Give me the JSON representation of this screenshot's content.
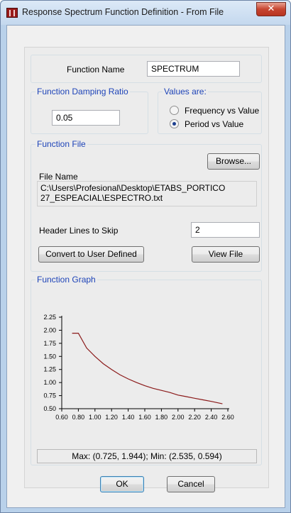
{
  "window": {
    "title": "Response Spectrum Function Definition - From File",
    "close_glyph": "✕"
  },
  "function_name": {
    "label": "Function Name",
    "value": "SPECTRUM"
  },
  "damping": {
    "group_title": "Function Damping Ratio",
    "value": "0.05"
  },
  "values_are": {
    "group_title": "Values are:",
    "options": [
      {
        "label": "Frequency vs Value",
        "checked": false
      },
      {
        "label": "Period vs Value",
        "checked": true
      }
    ]
  },
  "function_file": {
    "group_title": "Function File",
    "browse_label": "Browse...",
    "file_name_label": "File Name",
    "file_path_line1": "C:\\Users\\Profesional\\Desktop\\ETABS_PORTICO",
    "file_path_line2": "27_ESPEACIAL\\ESPECTRO.txt",
    "header_lines_label": "Header Lines to Skip",
    "header_lines_value": "2",
    "convert_label": "Convert to User Defined",
    "view_file_label": "View File"
  },
  "function_graph": {
    "group_title": "Function Graph",
    "status_text": "Max: (0.725, 1.944);   Min: (2.535, 0.594)"
  },
  "chart_data": {
    "type": "line",
    "x_ticks": [
      "0.60",
      "0.80",
      "1.00",
      "1.20",
      "1.40",
      "1.60",
      "1.80",
      "2.00",
      "2.20",
      "2.40",
      "2.60"
    ],
    "y_ticks": [
      "0.50",
      "0.75",
      "1.00",
      "1.25",
      "1.50",
      "1.75",
      "2.00",
      "2.25"
    ],
    "xlim": [
      0.6,
      2.6
    ],
    "ylim": [
      0.5,
      2.25
    ],
    "grid": false,
    "series": [
      {
        "color": "#8b1a1a",
        "x": [
          0.725,
          0.8,
          0.9,
          1.0,
          1.1,
          1.2,
          1.3,
          1.4,
          1.5,
          1.6,
          1.7,
          1.8,
          1.9,
          2.0,
          2.1,
          2.2,
          2.3,
          2.4,
          2.535
        ],
        "y": [
          1.944,
          1.944,
          1.66,
          1.5,
          1.36,
          1.25,
          1.15,
          1.07,
          1.0,
          0.94,
          0.89,
          0.85,
          0.81,
          0.76,
          0.73,
          0.7,
          0.67,
          0.64,
          0.594
        ]
      }
    ]
  },
  "buttons": {
    "ok_label": "OK",
    "cancel_label": "Cancel"
  }
}
